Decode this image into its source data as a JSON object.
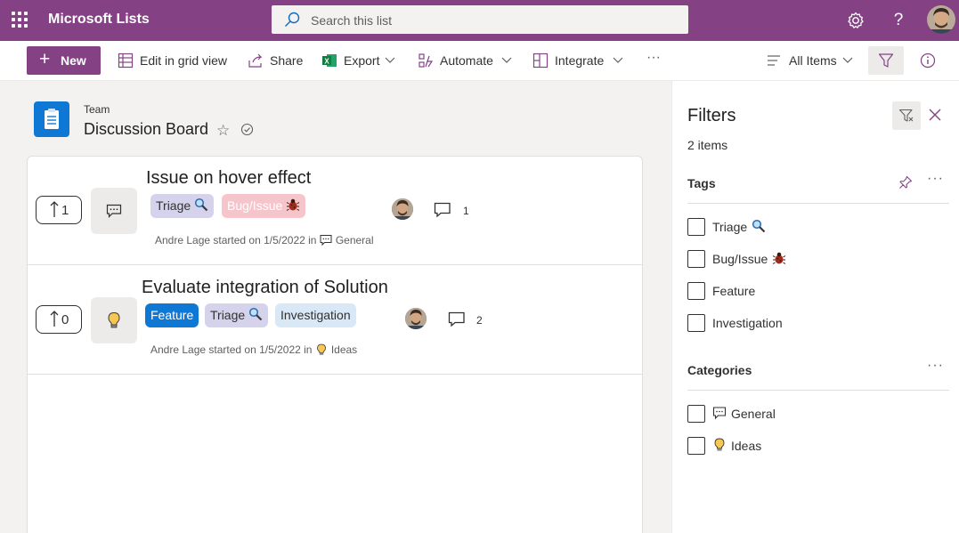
{
  "app": {
    "name": "Microsoft Lists"
  },
  "search": {
    "placeholder": "Search this list"
  },
  "commands": {
    "new": "New",
    "edit_grid": "Edit in grid view",
    "share": "Share",
    "export": "Export",
    "automate": "Automate",
    "integrate": "Integrate",
    "more": "···",
    "view": "All Items"
  },
  "list": {
    "group": "Team",
    "title": "Discussion Board"
  },
  "posts": [
    {
      "title": "Issue on hover effect",
      "votes": "1",
      "category_icon": "chat-icon",
      "tags": [
        "Triage",
        "Bug/Issue"
      ],
      "author": "Andre Lage",
      "meta_prefix": "Andre Lage started on 1/5/2022 in",
      "category": "General",
      "comments": "1"
    },
    {
      "title": "Evaluate integration of Solution",
      "votes": "0",
      "category_icon": "lightbulb-icon",
      "tags": [
        "Feature",
        "Triage",
        "Investigation"
      ],
      "author": "Andre Lage",
      "meta_prefix": "Andre Lage started on 1/5/2022 in",
      "category": "Ideas",
      "comments": "2"
    }
  ],
  "filters": {
    "title": "Filters",
    "count": "2 items",
    "tags_title": "Tags",
    "tags": [
      "Triage",
      "Bug/Issue",
      "Feature",
      "Investigation"
    ],
    "categories_title": "Categories",
    "categories": [
      "General",
      "Ideas"
    ],
    "more": "···"
  },
  "colors": {
    "suite_bar": "#844285",
    "accent": "#0f78d4",
    "triage_tag": "#d5d2ec",
    "bug_tag": "#f6c5cb",
    "investigation_tag": "#d8e8f6"
  }
}
